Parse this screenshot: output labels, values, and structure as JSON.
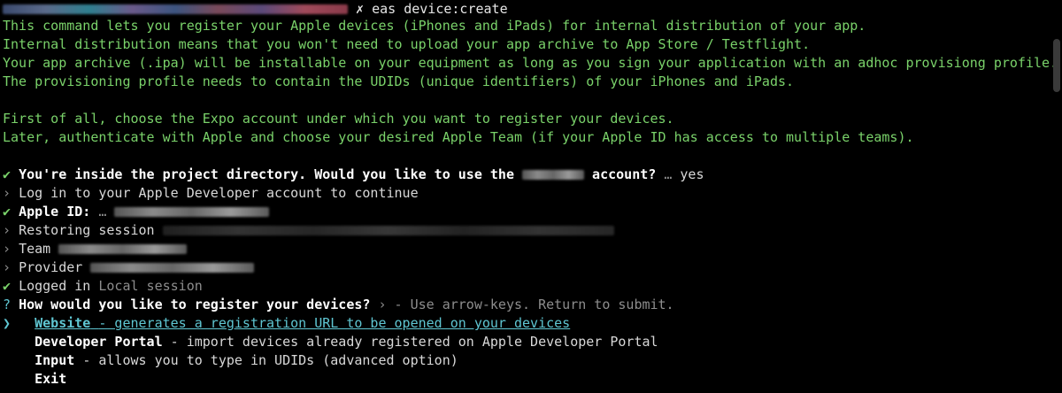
{
  "command": {
    "prompt_mark": "✗",
    "text": "eas device:create"
  },
  "intro_lines": [
    "This command lets you register your Apple devices (iPhones and iPads) for internal distribution of your app.",
    "Internal distribution means that you won't need to upload your app archive to App Store / Testflight.",
    "Your app archive (.ipa) will be installable on your equipment as long as you sign your application with an adhoc provisiong profile.",
    "The provisioning profile needs to contain the UDIDs (unique identifiers) of your iPhones and iPads.",
    "First of all, choose the Expo account under which you want to register your devices.",
    "Later, authenticate with Apple and choose your desired Apple Team (if your Apple ID has access to multiple teams)."
  ],
  "steps": {
    "check_mark": "✔",
    "arrow_mark": "›",
    "question_mark": "?",
    "project_dir": {
      "before": "You're inside the project directory. Would you like to use the",
      "after": "account?",
      "ellipsis": "…",
      "answer": "yes"
    },
    "login": "Log in to your Apple Developer account to continue",
    "apple_id": {
      "label": "Apple ID:",
      "ellipsis": "…"
    },
    "restoring": "Restoring session",
    "team": "Team",
    "provider": "Provider",
    "logged_in": {
      "label": "Logged in",
      "value": "Local session"
    }
  },
  "prompt": {
    "question": "How would you like to register your devices?",
    "arrow": "›",
    "hint": "- Use arrow-keys. Return to submit.",
    "pointer": "❯",
    "options": [
      {
        "name": "Website",
        "desc": "- generates a registration URL to be opened on your devices",
        "selected": true
      },
      {
        "name": "Developer Portal",
        "desc": "- import devices already registered on Apple Developer Portal",
        "selected": false
      },
      {
        "name": "Input",
        "desc": "- allows you to type in UDIDs (advanced option)",
        "selected": false
      },
      {
        "name": "Exit",
        "desc": "",
        "selected": false
      }
    ]
  },
  "colors": {
    "background": "#000000",
    "green": "#7ad26a",
    "cyan": "#5fc6d2",
    "dim": "#8d8d8d"
  }
}
